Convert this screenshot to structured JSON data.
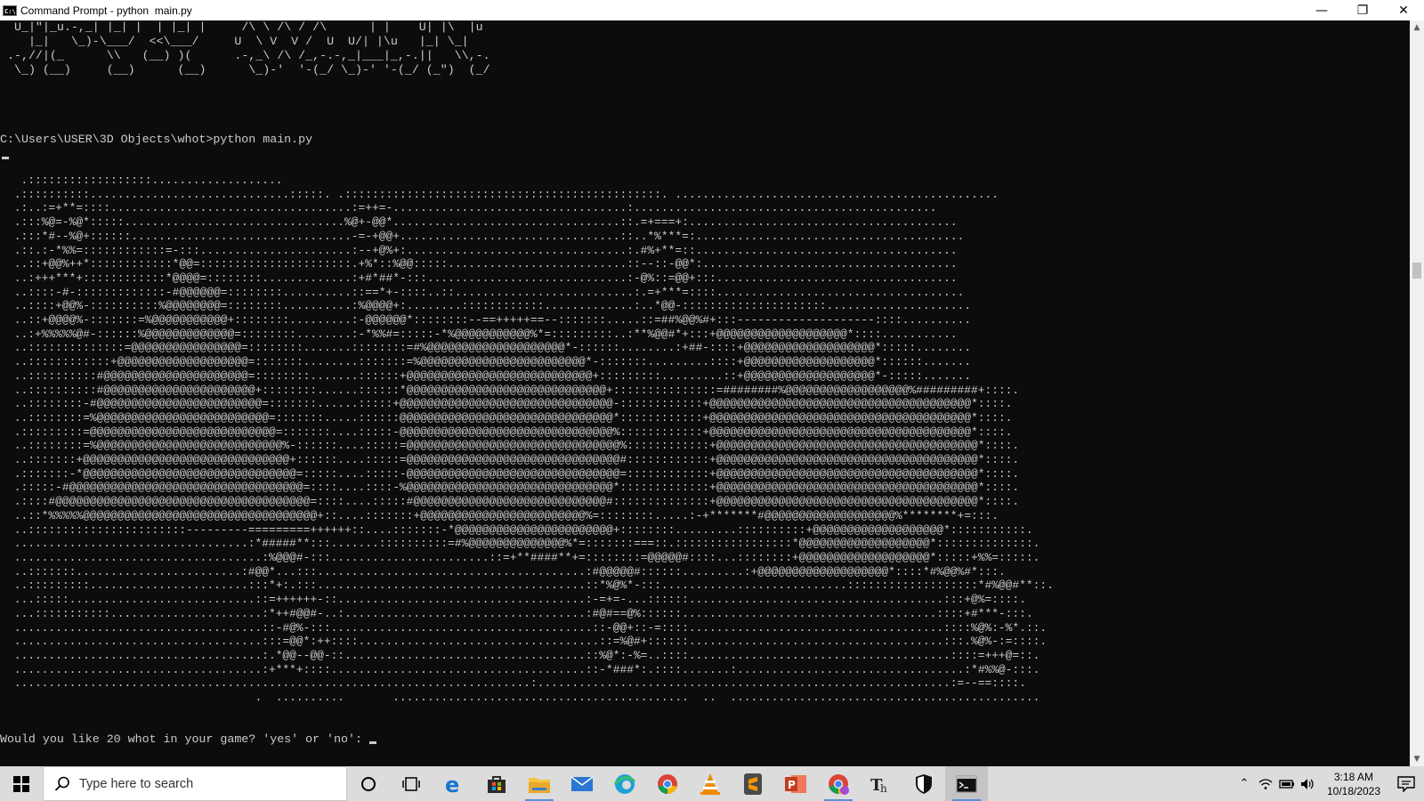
{
  "window": {
    "title": "Command Prompt - python  main.py",
    "icon_text": "C:\\",
    "controls": {
      "minimize": "—",
      "maximize": "❐",
      "close": "✕"
    }
  },
  "console": {
    "ascii_banner": " U_|\"|_u.-,_| |_| |  | |_| |     /\\ \\ /\\ / /\\      | |    U| |\\  |u\n   |_|   \\_)-\\___/  <<\\___/     U  \\ V  V /  U  U/| |\\u   |_| \\_|\n.-,//|(_      \\\\   (__) )(      .-,_\\ /\\ /_,-.-,_|___|_,-.||   \\\\,-.\n \\_) (__)     (__)      (__)      \\_)-'  '-(_/ \\_)-' '-(_/ (_\")  (_/",
    "prompt_line": "C:\\Users\\USER\\3D Objects\\whot>python main.py",
    "ascii_art": "  .::::::::::::::::::...................\n .::::::::::.............................:::::. .::::::::::::::::::::::::::::::::::::::::::::::. ...............................................\n .:..:=+**=::::...................................:=++=-..................................:............................................\n .:::%@=-%@*:::::................................%@+-@@*.................................::.=+===+:.......................................\n .:::*#--%@+::::::................................-=-+@@+................................::..*%***=:.......................................\n .::.:-*%%=::::::::::::=-:::......................:--+@%+:................................:.#%+**=::......................................\n ..::+@@%++*::::::::::::*@@=::::::::::::::::::::::.+%*::%@@:::::..........................::--::-@@*:.....................................\n ..:+++***+::::::::::::*@@@@=::::::::.............:+#*##*-:::.............................:-@%::=@@+:::...................................\n ..::::-#-:::::::::::::-#@@@@@@=::::::::..........::==*+-::::..::..........................:.=+***=::::....................................\n ..::::+@@%-::::::::::%@@@@@@@@=::::::::..........:%@@@@+:........::::::::::::.............:..*@@-:::::::::::::::::::::.....................\n ..::+@@@@%-:::::::=%@@@@@@@@@@@+::::::::.........:-@@@@@@*::::::::--==+++++==--:::::::.....::=##%@@%#+:::--------------------::::..........\n ..:+%%%%%@#-::::::%@@@@@@@@@@@@@=::::::::........:-*%%#=:::::-*%@@@@@@@@@@@%*=:::::::::..:**%@@#*+:::+@@@@@@@@@@@@@@@@@@@*::::...........\n ..::::::::::::::=@@@@@@@@@@@@@@@@=::::::::.......::::::::=#%@@@@@@@@@@@@@@@@@@@@*-::::::........:+##-::::+@@@@@@@@@@@@@@@@@@@*:::::........\n ..::::::::::::+@@@@@@@@@@@@@@@@@@@=:::::::........:::::::=%@@@@@@@@@@@@@@@@@@@@@@@@*-:::::::.........::::+@@@@@@@@@@@@@@@@@@@*::::::.......\n ..::::::::::#@@@@@@@@@@@@@@@@@@@@@=::::::::.......::::::+@@@@@@@@@@@@@@@@@@@@@@@@@@@+:::::::::.........::+@@@@@@@@@@@@@@@@@@@*-:::::.......\n ..::::::::::#@@@@@@@@@@@@@@@@@@@@@@+::::::::......::::::*@@@@@@@@@@@@@@@@@@@@@@@@@@@@@+:::::::::::::::=########%@@@@@@@@@@@@@@@@@@%#########+::::.\n ..::::::::-#@@@@@@@@@@@@@@@@@@@@@@@@=:::::::......:::::+@@@@@@@@@@@@@@@@@@@@@@@@@@@@@@@-::::::::::::+@@@@@@@@@@@@@@@@@@@@@@@@@@@@@@@@@@@@@@*::::.\n ..::::::::=%@@@@@@@@@@@@@@@@@@@@@@@@@=:::::::.....::::::@@@@@@@@@@@@@@@@@@@@@@@@@@@@@@@*::::::::::::+@@@@@@@@@@@@@@@@@@@@@@@@@@@@@@@@@@@@@@*::::.\n .:::::::::=@@@@@@@@@@@@@@@@@@@@@@@@@@@=:::::::....:::::-@@@@@@@@@@@@@@@@@@@@@@@@@@@@@@@%::::::::::::+@@@@@@@@@@@@@@@@@@@@@@@@@@@@@@@@@@@@@@*::::.\n ..::::::::=%@@@@@@@@@@@@@@@@@@@@@@@@@@@%-::::::....:::::=@@@@@@@@@@@@@@@@@@@@@@@@@@@@@@@%::::::::::::+@@@@@@@@@@@@@@@@@@@@@@@@@@@@@@@@@@@@@@*::::.\n ..:::::::+@@@@@@@@@@@@@@@@@@@@@@@@@@@@@@+::::::....:::::=@@@@@@@@@@@@@@@@@@@@@@@@@@@@@@@#::::::::::::+@@@@@@@@@@@@@@@@@@@@@@@@@@@@@@@@@@@@@@*::::.\n .:::::::-*@@@@@@@@@@@@@@@@@@@@@@@@@@@@@@@=:::::....:::::-@@@@@@@@@@@@@@@@@@@@@@@@@@@@@@@=::::::::::::+@@@@@@@@@@@@@@@@@@@@@@@@@@@@@@@@@@@@@@*::::.\n .:::::-#@@@@@@@@@@@@@@@@@@@@@@@@@@@@@@@@@@=::::....::::-%@@@@@@@@@@@@@@@@@@@@@@@@@@@@@@*:::::::::::::+@@@@@@@@@@@@@@@@@@@@@@@@@@@@@@@@@@@@@@*::::.\n .::::#@@@@@@@@@@@@@@@@@@@@@@@@@@@@@@@@@@@@@=::::....:::::#@@@@@@@@@@@@@@@@@@@@@@@@@@@@#::::::::::::::+@@@@@@@@@@@@@@@@@@@@@@@@@@@@@@@@@@@@@@*::::.\n ..::*%%%%%@@@@@@@@@@@@@@@@@@@@@@@@@@@@@@@@@@+::....:::::::+@@@@@@@@@@@@@@@@@@@@@@@@%=::::::::.....:-+*******#@@@@@@@@@@@@@@@@@@@%********+=:::.\n ..:::::::::::::::::::::::---------=========++++++::....:::::::-*@@@@@@@@@@@@@@@@@@@@@@@+::::::::.........::::::::::+@@@@@@@@@@@@@@@@@@@*:::::::::::.\n ..................................:*#####**:::.......::::::::::=#%@@@@@@@@@@@@@@%*=:::::::===::.:::::::::::::::::*@@@@@@@@@@@@@@@@@@@*::::::::::::::.\n ....................................:%@@@#-:::.......................::=+**####**+=::::::::=@@@@@#::::...::::::::+@@@@@@@@@@@@@@@@@@@*:::::+%%=:::::.\n ..:::::::........................:#@@*...:::.......................................:#@@@@@#::::::.........:+@@@@@@@@@@@@@@@@@@@*::::*#%@@%#*:::.\n ..:::::::::.......................:::*+:.:::.......................................::*%@%*-:::...........................:::::::::::::::::::*#%@@#**::.\n ...:::::...........................::=++++++-::....................................:-=+=-...::::::.....................................:::+@%=::::.\n ...:::::::::::......................:*++#@@#-..:...................................:#@#==@%::::::.....................................::::+#***-:::.\n ....................................::-#@%-:::......................................::-@@+::-=::::.....................................::::%@%:-%*.::.\n ....................................:::=@@*:++::::...................................::=%@#+::::::.....................................:::.%@%-:=::::.\n ....................................:.*@@--@@-::...................................::%@*:-%=..::::......................................::::=+++@=::.\n ....................................:+***+::::.....................................::-*###*:.::::.......:.................................:*#%%@-:::.\n ...........................................................................:............................................................:=--==::::.\n                                    .  ..........       ...........................................  ..  .............................................",
    "question": "Would you like 20 whot in your game? 'yes' or 'no': "
  },
  "scrollbar": {
    "up_arrow": "▲",
    "down_arrow": "▼"
  },
  "taskbar": {
    "search_placeholder": "Type here to search",
    "apps": [
      "cortana-icon",
      "task-view-icon",
      "edge-legacy-icon",
      "store-icon",
      "file-explorer-icon",
      "mail-icon",
      "edge-icon",
      "chrome-icon",
      "vlc-icon",
      "sublime-text-icon",
      "powerpoint-icon",
      "chrome-profile-icon",
      "typora-icon",
      "defender-icon",
      "command-prompt-icon"
    ],
    "clock": {
      "time": "3:18 AM",
      "date": "10/18/2023"
    },
    "tray": {
      "chevron": "⌃"
    }
  },
  "colors": {
    "console_bg": "#0c0c0c",
    "console_fg": "#cccccc",
    "taskbar_bg": "#dcdcdc",
    "accent": "#5a8fd6"
  }
}
